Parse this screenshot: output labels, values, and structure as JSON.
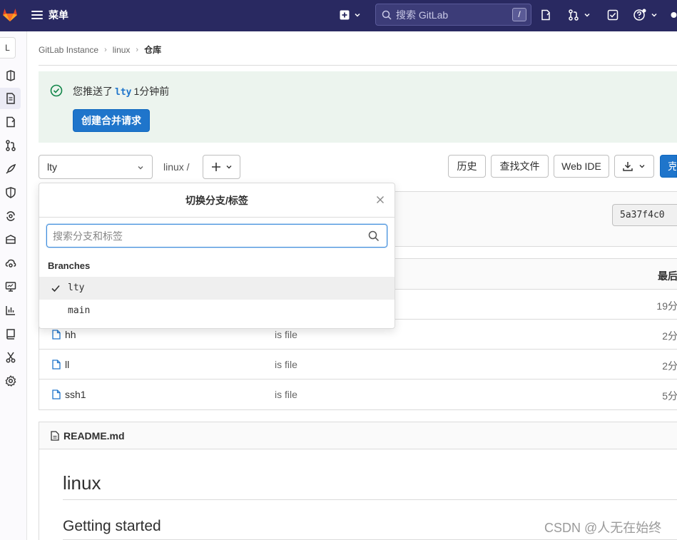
{
  "topbar": {
    "menu_label": "菜单",
    "search_placeholder": "搜索 GitLab",
    "search_shortcut": "/"
  },
  "sidebar": {
    "project_initial": "L"
  },
  "breadcrumb": {
    "items": [
      "GitLab Instance",
      "linux",
      "仓库"
    ]
  },
  "alert": {
    "prefix": "您推送了",
    "branch": "lty",
    "suffix": "1分钟前",
    "button": "创建合并请求"
  },
  "toolbar": {
    "branch": "lty",
    "path": "linux  /",
    "history": "历史",
    "find_file": "查找文件",
    "web_ide": "Web IDE",
    "clone_partial": "克"
  },
  "commit": {
    "sha": "5a37f4c0"
  },
  "table": {
    "last_update_header": "最后",
    "rows": [
      {
        "name": "",
        "message": "",
        "time": "19分"
      },
      {
        "name": "hh",
        "message": "is file",
        "time": "2分"
      },
      {
        "name": "ll",
        "message": "is file",
        "time": "2分"
      },
      {
        "name": "ssh1",
        "message": "is file",
        "time": "5分"
      }
    ]
  },
  "readme": {
    "filename": "README.md",
    "h1": "linux",
    "h2": "Getting started"
  },
  "dropdown": {
    "title": "切换分支/标签",
    "search_placeholder": "搜索分支和标签",
    "section": "Branches",
    "items": [
      {
        "label": "lty",
        "selected": true
      },
      {
        "label": "main",
        "selected": false
      }
    ]
  },
  "watermark": "CSDN @人无在始终",
  "colors": {
    "navbar": "#292961",
    "primary": "#1f75cb",
    "success_bg": "#ecf4ee",
    "success_icon": "#108548"
  }
}
